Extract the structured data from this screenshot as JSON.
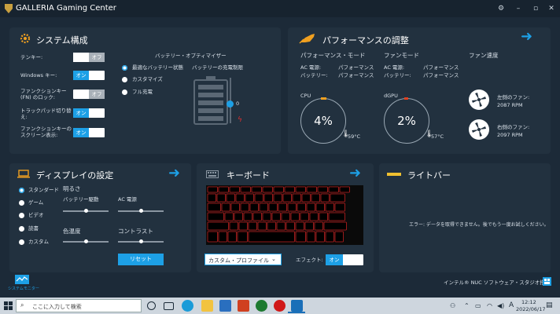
{
  "app": {
    "title": "GALLERIA Gaming Center"
  },
  "system": {
    "title": "システム構成",
    "rows": [
      {
        "label": "テンキー:",
        "state": "オフ"
      },
      {
        "label": "Windows キー:",
        "state": "オン"
      },
      {
        "label": "ファンクションキー (FN) のロック:",
        "state": "オフ"
      },
      {
        "label": "トラックパッド切り替え:",
        "state": "オン"
      },
      {
        "label": "ファンクションキーのスクリーン表示:",
        "state": "オン"
      }
    ],
    "battery": {
      "title": "バッテリー・オプティマイザー",
      "options": [
        "最適なバッテリー状態",
        "カスタマイズ",
        "フル充電"
      ],
      "limit_label": "バッテリーの充電制限",
      "limit_value": "0"
    }
  },
  "performance": {
    "title": "パフォーマンスの調整",
    "mode_title": "パフォーマンス・モード",
    "mode_rows": [
      {
        "label": "AC 電源:",
        "value": "パフォーマンス"
      },
      {
        "label": "バッテリー:",
        "value": "パフォーマンス"
      }
    ],
    "fan_mode_title": "ファンモード",
    "fan_rows": [
      {
        "label": "AC 電源:",
        "value": "パフォーマンス"
      },
      {
        "label": "バッテリー:",
        "value": "パフォーマンス"
      }
    ],
    "fan_speed_title": "ファン速度",
    "cpu": {
      "label": "CPU",
      "pct": "4%",
      "temp": "59°C",
      "fraction": 0.04
    },
    "gpu": {
      "label": "dGPU",
      "pct": "2%",
      "temp": "57°C",
      "fraction": 0.02
    },
    "left_fan": {
      "label": "左側のファン:",
      "rpm": "2087 RPM"
    },
    "right_fan": {
      "label": "右側のファン:",
      "rpm": "2097 RPM"
    }
  },
  "display": {
    "title": "ディスプレイの設定",
    "modes": [
      "スタンダード",
      "ゲーム",
      "ビデオ",
      "読書",
      "カスタム"
    ],
    "brightness_title": "明るさ",
    "battery_drive": "バッテリー駆動",
    "ac_power": "AC 電源",
    "color_temp": "色温度",
    "contrast": "コントラスト",
    "reset": "リセット",
    "levels": {
      "brightness_battery": 0.5,
      "brightness_ac": 0.5,
      "color_temp": 0.5,
      "contrast": 0.5
    }
  },
  "keyboard": {
    "title": "キーボード",
    "profile": "カスタム・プロファイル",
    "effect_label": "エフェクト:",
    "effect_state": "オン"
  },
  "lightbar": {
    "title": "ライトバー",
    "error": "エラー: データを取得できません。後でもう一度お試しください。"
  },
  "footer": {
    "app_label": "システムモニター",
    "brand": "インテル® NUC ソフトウェア・スタジオ搭載"
  },
  "taskbar": {
    "search_placeholder": "ここに入力して検索",
    "time": "12:12",
    "date": "2022/06/17",
    "ime": "A"
  },
  "colors": {
    "accent": "#1da0e6",
    "orange": "#f0a020",
    "keyboard_red": "#c02020",
    "panel": "#22313f"
  }
}
